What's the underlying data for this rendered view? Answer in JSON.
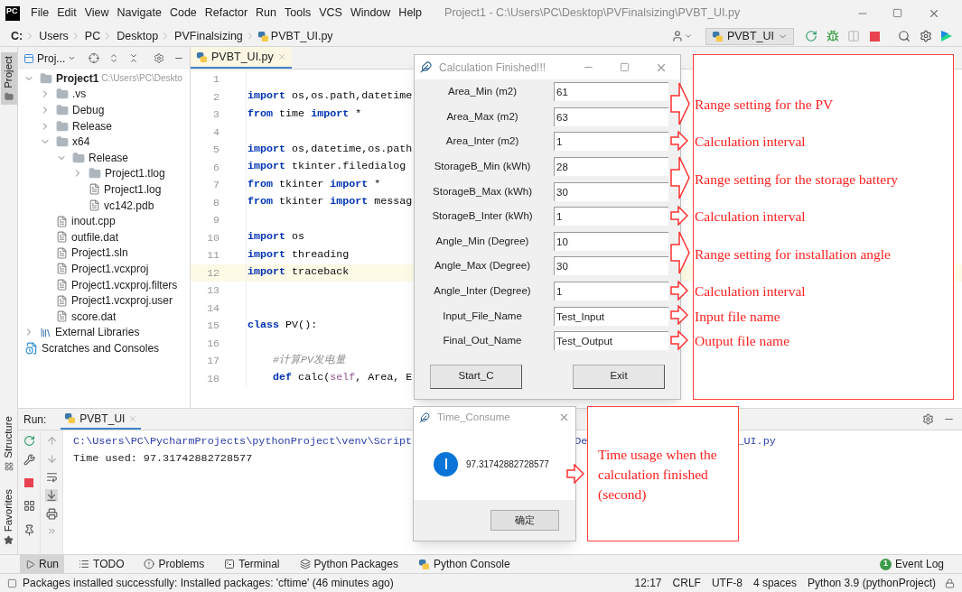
{
  "menu_bar": {
    "logo": "PC",
    "items": [
      "File",
      "Edit",
      "View",
      "Navigate",
      "Code",
      "Refactor",
      "Run",
      "Tools",
      "VCS",
      "Window",
      "Help"
    ],
    "title": "Project1 - C:\\Users\\PC\\Desktop\\PVFinalsizing\\PVBT_UI.py"
  },
  "breadcrumb": {
    "items": [
      "C:",
      "Users",
      "PC",
      "Desktop",
      "PVFinalsizing",
      "PVBT_UI.py"
    ]
  },
  "toolbar": {
    "run_config": "PVBT_UI"
  },
  "side_tabs": [
    {
      "label": "Project",
      "selected": true
    },
    {
      "label": "Structure",
      "selected": false
    },
    {
      "label": "Favorites",
      "selected": false
    }
  ],
  "project_panel": {
    "title": "Proj...",
    "tree": [
      {
        "kind": "folder",
        "label": "Project1",
        "path": "C:\\Users\\PC\\Deskto",
        "expanded": true,
        "children": [
          {
            "kind": "folder",
            "label": ".vs",
            "expanded": false
          },
          {
            "kind": "folder",
            "label": "Debug",
            "expanded": false
          },
          {
            "kind": "folder",
            "label": "Release",
            "expanded": false
          },
          {
            "kind": "folder",
            "label": "x64",
            "expanded": true,
            "children": [
              {
                "kind": "folder",
                "label": "Release",
                "expanded": true,
                "children": [
                  {
                    "kind": "folder",
                    "label": "Project1.tlog",
                    "expanded": false
                  },
                  {
                    "kind": "file",
                    "label": "Project1.log"
                  },
                  {
                    "kind": "file",
                    "label": "vc142.pdb"
                  }
                ]
              }
            ]
          },
          {
            "kind": "file",
            "label": "inout.cpp"
          },
          {
            "kind": "file",
            "label": "outfile.dat"
          },
          {
            "kind": "file",
            "label": "Project1.sln"
          },
          {
            "kind": "file",
            "label": "Project1.vcxproj"
          },
          {
            "kind": "file",
            "label": "Project1.vcxproj.filters"
          },
          {
            "kind": "file",
            "label": "Project1.vcxproj.user"
          },
          {
            "kind": "file",
            "label": "score.dat"
          }
        ]
      },
      {
        "kind": "library",
        "label": "External Libraries",
        "expanded": false
      },
      {
        "kind": "scratches",
        "label": "Scratches and Consoles"
      }
    ]
  },
  "editor": {
    "tabs": [
      {
        "label": "PVBT_UI.py",
        "selected": true
      }
    ],
    "lines": [
      {
        "number": "1",
        "current": false
      },
      {
        "number": "2",
        "current": false,
        "tokens": [
          {
            "kind": "keyword",
            "text": "import"
          },
          {
            "kind": "plain",
            "text": " os,os.path,datetime"
          }
        ]
      },
      {
        "number": "3",
        "current": false,
        "tokens": [
          {
            "kind": "keyword",
            "text": "from"
          },
          {
            "kind": "plain",
            "text": " time "
          },
          {
            "kind": "keyword",
            "text": "import"
          },
          {
            "kind": "plain",
            "text": " *"
          }
        ]
      },
      {
        "number": "4",
        "current": false
      },
      {
        "number": "5",
        "current": false,
        "tokens": [
          {
            "kind": "keyword",
            "text": "import"
          },
          {
            "kind": "plain",
            "text": " os,datetime,os.path"
          }
        ]
      },
      {
        "number": "6",
        "current": false,
        "tokens": [
          {
            "kind": "keyword",
            "text": "import"
          },
          {
            "kind": "plain",
            "text": " tkinter.filedialog"
          }
        ]
      },
      {
        "number": "7",
        "current": false,
        "tokens": [
          {
            "kind": "keyword",
            "text": "from"
          },
          {
            "kind": "plain",
            "text": " tkinter "
          },
          {
            "kind": "keyword",
            "text": "import"
          },
          {
            "kind": "plain",
            "text": " *"
          }
        ]
      },
      {
        "number": "8",
        "current": false,
        "tokens": [
          {
            "kind": "keyword",
            "text": "from"
          },
          {
            "kind": "plain",
            "text": " tkinter "
          },
          {
            "kind": "keyword",
            "text": "import"
          },
          {
            "kind": "plain",
            "text": " messag"
          }
        ]
      },
      {
        "number": "9",
        "current": false
      },
      {
        "number": "10",
        "current": false,
        "tokens": [
          {
            "kind": "keyword",
            "text": "import"
          },
          {
            "kind": "plain",
            "text": " os"
          }
        ]
      },
      {
        "number": "11",
        "current": false,
        "tokens": [
          {
            "kind": "keyword",
            "text": "import"
          },
          {
            "kind": "plain",
            "text": " threading"
          }
        ]
      },
      {
        "number": "12",
        "current": true,
        "tokens": [
          {
            "kind": "keyword",
            "text": "import"
          },
          {
            "kind": "plain",
            "text": " traceback"
          }
        ]
      },
      {
        "number": "13",
        "current": false
      },
      {
        "number": "14",
        "current": false
      },
      {
        "number": "15",
        "current": false,
        "tokens": [
          {
            "kind": "keyword",
            "text": "class"
          },
          {
            "kind": "plain",
            "text": " PV():"
          }
        ]
      },
      {
        "number": "16",
        "current": false
      },
      {
        "number": "17",
        "current": false,
        "tokens": [
          {
            "kind": "comment",
            "text": "    #计算PV发电量"
          }
        ]
      },
      {
        "number": "18",
        "current": false,
        "tokens": [
          {
            "kind": "keyword",
            "text": "    def"
          },
          {
            "kind": "plain",
            "text": " calc("
          },
          {
            "kind": "self",
            "text": "self"
          },
          {
            "kind": "plain",
            "text": ", Area, E"
          }
        ]
      }
    ]
  },
  "run_panel": {
    "title": "Run:",
    "tabs": [
      {
        "label": "PVBT_UI",
        "selected": true
      }
    ],
    "console": [
      {
        "kind": "path",
        "segments": [
          "C:\\Users\\PC\\PycharmProjects\\pythonProject\\venv\\Script",
          "De",
          "_UI.py"
        ]
      },
      {
        "kind": "output",
        "segments": [
          "Time used: 97.31742882728577"
        ]
      }
    ]
  },
  "tool_tabs": [
    {
      "kind": "run",
      "label": "Run",
      "selected": true
    },
    {
      "kind": "todo",
      "label": "TODO",
      "selected": false
    },
    {
      "kind": "problems",
      "label": "Problems",
      "selected": false
    },
    {
      "kind": "terminal",
      "label": "Terminal",
      "selected": false
    },
    {
      "kind": "packages",
      "label": "Python Packages",
      "selected": false
    },
    {
      "kind": "console",
      "label": "Python Console",
      "selected": false
    }
  ],
  "event_log": {
    "count": "1",
    "label": "Event Log"
  },
  "status_bar": {
    "message": "Packages installed successfully: Installed packages: 'cftime' (46 minutes ago)",
    "items": [
      "12:17",
      "CRLF",
      "UTF-8",
      "4 spaces",
      "Python 3.9 (pythonProject)"
    ]
  },
  "calc_dialog": {
    "title": "Calculation Finished!!!",
    "fields": [
      {
        "label": "Area_Min (m2)",
        "value": "61"
      },
      {
        "label": "Area_Max (m2)",
        "value": "63"
      },
      {
        "label": "Area_Inter (m2)",
        "value": "1"
      },
      {
        "label": "StorageB_Min (kWh)",
        "value": "28"
      },
      {
        "label": "StorageB_Max (kWh)",
        "value": "30"
      },
      {
        "label": "StorageB_Inter (kWh)",
        "value": "1"
      },
      {
        "label": "Angle_Min (Degree)",
        "value": "10"
      },
      {
        "label": "Angle_Max (Degree)",
        "value": "30"
      },
      {
        "label": "Angle_Inter (Degree)",
        "value": "1"
      },
      {
        "label": "Input_File_Name",
        "value": "Test_Input"
      },
      {
        "label": "Final_Out_Name",
        "value": "Test_Output"
      }
    ],
    "buttons": [
      "Start_C",
      "Exit"
    ]
  },
  "annotations": [
    {
      "kind": "range",
      "text": "Range setting for the PV"
    },
    {
      "kind": "single",
      "text": "Calculation interval"
    },
    {
      "kind": "range",
      "text": "Range setting for the storage battery"
    },
    {
      "kind": "single",
      "text": "Calculation interval"
    },
    {
      "kind": "range",
      "text": "Range setting for installation angle"
    },
    {
      "kind": "single",
      "text": "Calculation interval"
    },
    {
      "kind": "single",
      "text": "Input file name"
    },
    {
      "kind": "single",
      "text": "Output file name"
    }
  ],
  "time_dialog": {
    "title": "Time_Consume",
    "message": "97.31742882728577",
    "button": "确定"
  },
  "time_annotation": {
    "text": "Time usage when the calculation finished (second)"
  }
}
